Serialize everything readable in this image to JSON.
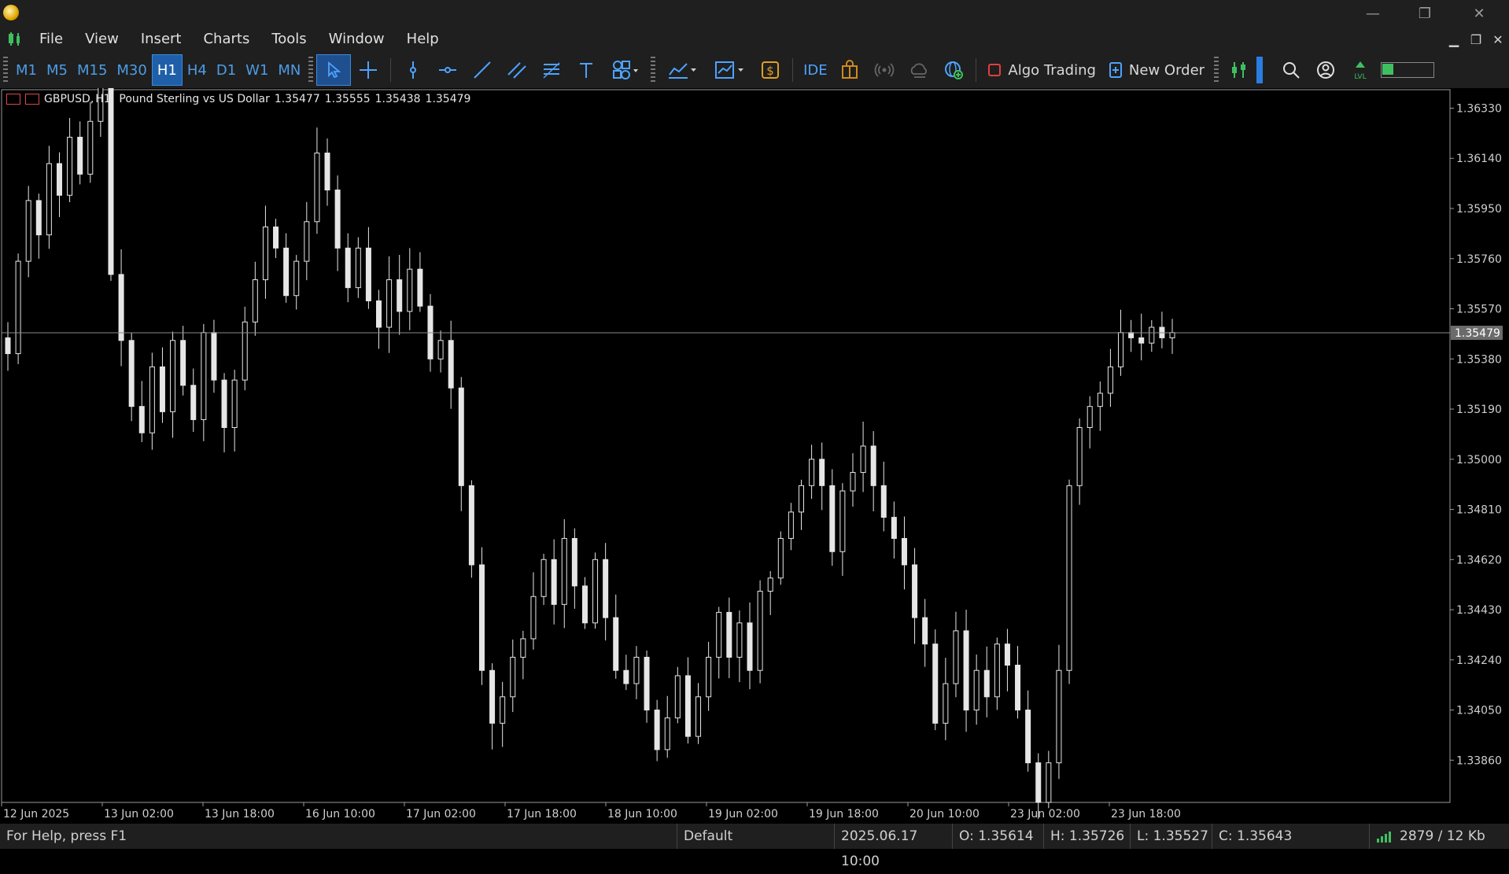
{
  "window": {
    "minimize": "—",
    "restore": "❐",
    "close": "✕"
  },
  "menu": [
    "File",
    "View",
    "Insert",
    "Charts",
    "Tools",
    "Window",
    "Help"
  ],
  "timeframes": [
    "M1",
    "M5",
    "M15",
    "M30",
    "H1",
    "H4",
    "D1",
    "W1",
    "MN"
  ],
  "active_timeframe": "H1",
  "toolbar": {
    "algo_label": "Algo Trading",
    "new_order_label": "New Order",
    "ide_label": "IDE"
  },
  "chart_header": {
    "symbol": "GBPUSD",
    "timeframe": "H1",
    "description": "Pound Sterling vs US Dollar",
    "open": "1.35477",
    "high": "1.35555",
    "low": "1.35438",
    "close": "1.35479"
  },
  "price_axis": [
    "1.36330",
    "1.36140",
    "1.35950",
    "1.35760",
    "1.35570",
    "1.35380",
    "1.35190",
    "1.35000",
    "1.34810",
    "1.34620",
    "1.34430",
    "1.34240",
    "1.34050",
    "1.33860"
  ],
  "current_price": "1.35479",
  "time_axis": [
    "12 Jun 2025",
    "13 Jun 02:00",
    "13 Jun 18:00",
    "16 Jun 10:00",
    "17 Jun 02:00",
    "17 Jun 18:00",
    "18 Jun 10:00",
    "19 Jun 02:00",
    "19 Jun 18:00",
    "20 Jun 10:00",
    "23 Jun 02:00",
    "23 Jun 18:00"
  ],
  "status": {
    "help": "For Help, press F1",
    "profile": "Default",
    "time": "2025.06.17 10:00",
    "open": "O: 1.35614",
    "high": "H: 1.35726",
    "low": "L: 1.35527",
    "close": "C: 1.35643",
    "traffic": "2879 / 12 Kb"
  },
  "chart_data": {
    "type": "candlestick",
    "symbol": "GBPUSD",
    "period": "H1",
    "ylim": [
      1.337,
      1.364
    ],
    "path_close": [
      1.354,
      1.3575,
      1.3598,
      1.3585,
      1.3612,
      1.36,
      1.3622,
      1.3608,
      1.3628,
      1.3645,
      1.357,
      1.3545,
      1.352,
      1.351,
      1.3535,
      1.3518,
      1.3545,
      1.3528,
      1.3515,
      1.3548,
      1.353,
      1.3512,
      1.353,
      1.3552,
      1.3568,
      1.3588,
      1.358,
      1.3562,
      1.3575,
      1.359,
      1.3616,
      1.3602,
      1.358,
      1.3565,
      1.358,
      1.356,
      1.355,
      1.3568,
      1.3556,
      1.3572,
      1.3558,
      1.3538,
      1.3545,
      1.3527,
      1.349,
      1.346,
      1.342,
      1.34,
      1.341,
      1.3425,
      1.3432,
      1.3448,
      1.3462,
      1.3445,
      1.347,
      1.3452,
      1.3438,
      1.3462,
      1.344,
      1.342,
      1.3415,
      1.3425,
      1.3405,
      1.339,
      1.3402,
      1.3418,
      1.3395,
      1.341,
      1.3425,
      1.3442,
      1.3425,
      1.3438,
      1.342,
      1.345,
      1.3455,
      1.347,
      1.348,
      1.349,
      1.35,
      1.349,
      1.3465,
      1.3488,
      1.3495,
      1.3505,
      1.349,
      1.3478,
      1.347,
      1.346,
      1.344,
      1.343,
      1.34,
      1.3415,
      1.3435,
      1.3405,
      1.342,
      1.341,
      1.343,
      1.3422,
      1.3405,
      1.3385,
      1.337,
      1.3385,
      1.342,
      1.349,
      1.3512,
      1.352,
      1.3525,
      1.3535,
      1.3548,
      1.3546,
      1.3544,
      1.355,
      1.3546,
      1.3548
    ]
  }
}
